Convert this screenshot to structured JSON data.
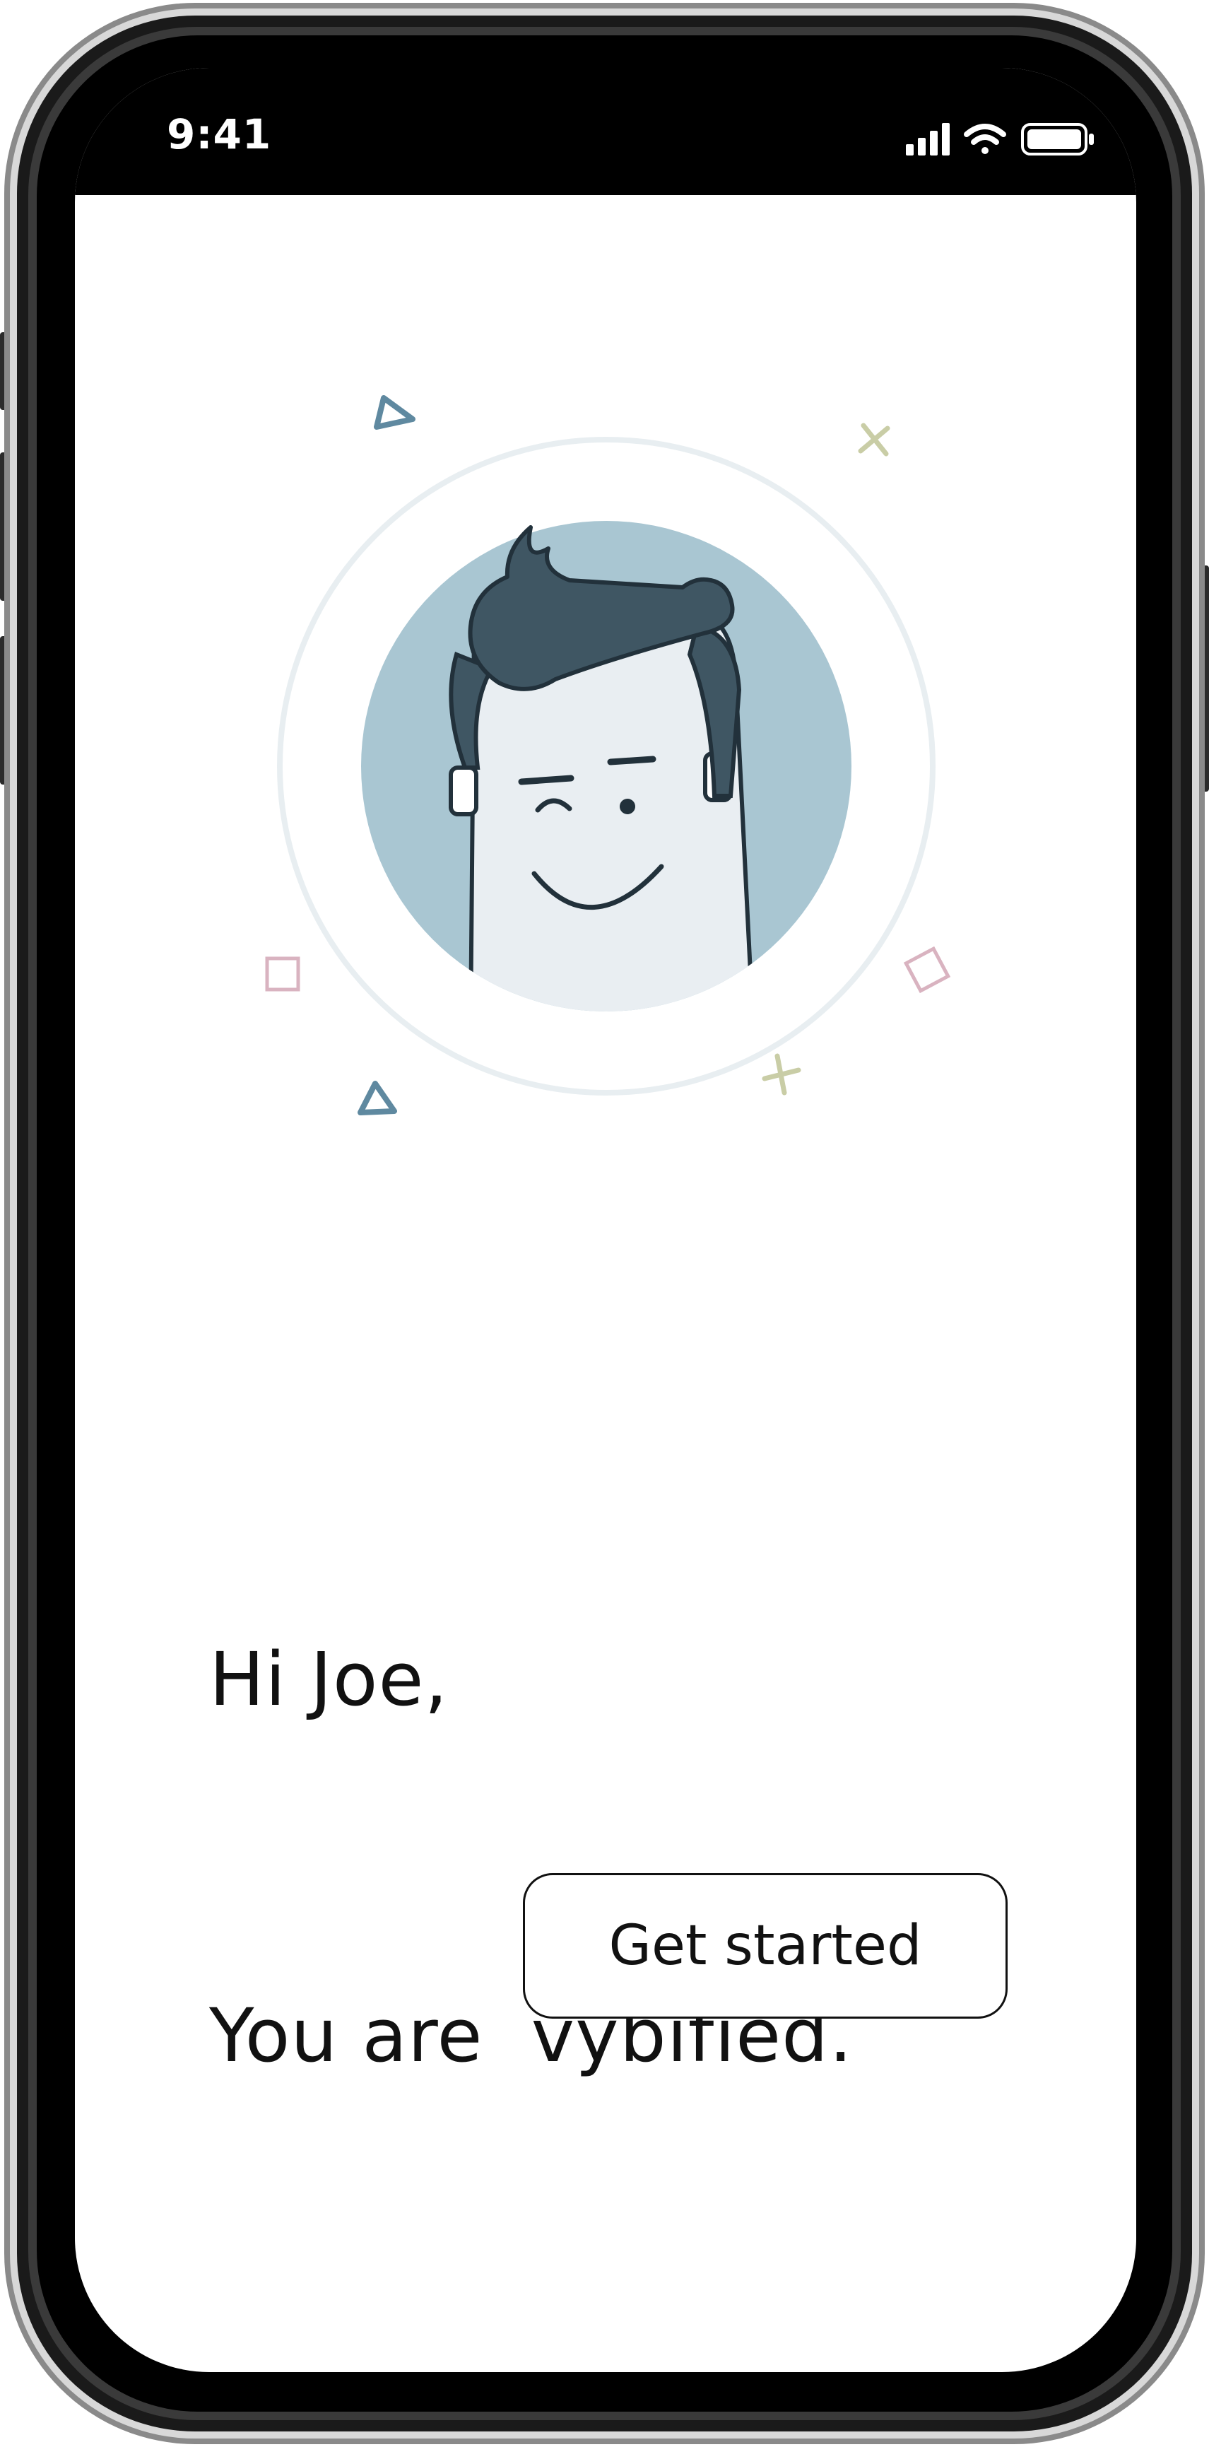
{
  "status_bar": {
    "time": "9:41",
    "signal_icon": "cellular-signal-icon",
    "wifi_icon": "wifi-icon",
    "battery_icon": "battery-icon"
  },
  "illustration": {
    "avatar": "winking-man-avatar",
    "decorations": [
      "triangle-icon",
      "cross-icon",
      "square-icon",
      "diamond-icon",
      "triangle-icon",
      "cross-icon"
    ],
    "colors": {
      "avatar_bg": "#a9c6d2",
      "ring": "#e8eef1",
      "hair": "#3f5663",
      "face": "#e9eef2",
      "outline": "#22313b",
      "triangle": "#5f89a0",
      "cross": "#c9cda6",
      "square": "#d9b3c0"
    }
  },
  "greeting": {
    "line1": "Hi Joe,",
    "line2": "You are  vybified."
  },
  "cta": {
    "label": "Get started"
  }
}
